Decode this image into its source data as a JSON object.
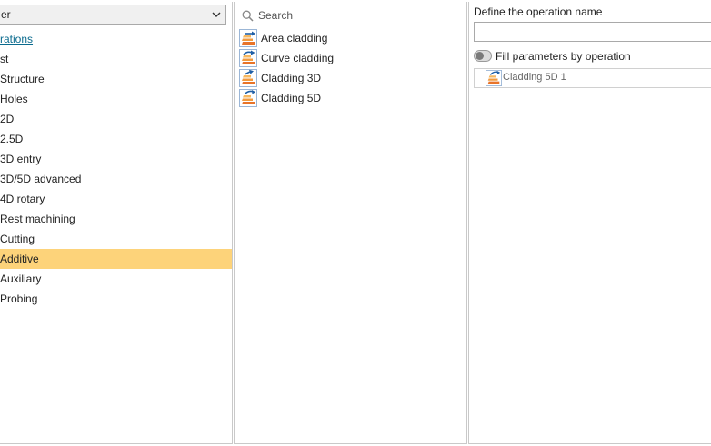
{
  "left_panel": {
    "category_combo": {
      "value": "er"
    },
    "category_link": "rations",
    "categories": [
      {
        "label": "st",
        "selected": false
      },
      {
        "label": "Structure",
        "selected": false
      },
      {
        "label": "Holes",
        "selected": false
      },
      {
        "label": "2D",
        "selected": false
      },
      {
        "label": "2.5D",
        "selected": false
      },
      {
        "label": "3D entry",
        "selected": false
      },
      {
        "label": "3D/5D advanced",
        "selected": false
      },
      {
        "label": "4D rotary",
        "selected": false
      },
      {
        "label": "Rest machining",
        "selected": false
      },
      {
        "label": "Cutting",
        "selected": false
      },
      {
        "label": "Additive",
        "selected": true
      },
      {
        "label": "Auxiliary",
        "selected": false
      },
      {
        "label": "Probing",
        "selected": false
      }
    ]
  },
  "middle_panel": {
    "search_label": "Search",
    "operations": [
      {
        "label": "Area cladding",
        "icon": "area-cladding-icon"
      },
      {
        "label": "Curve cladding",
        "icon": "curve-cladding-icon"
      },
      {
        "label": "Cladding 3D",
        "icon": "cladding-3d-icon"
      },
      {
        "label": "Cladding 5D",
        "icon": "cladding-5d-icon"
      }
    ]
  },
  "right_panel": {
    "define_label": "Define the operation name",
    "name_value": "",
    "fill_label": "Fill parameters by operation",
    "fill_enabled": false,
    "instance_label": "Cladding 5D 1"
  },
  "colors": {
    "selected_row": "#fdd37a",
    "link": "#0b6b8e",
    "border": "#c9c9c9"
  }
}
